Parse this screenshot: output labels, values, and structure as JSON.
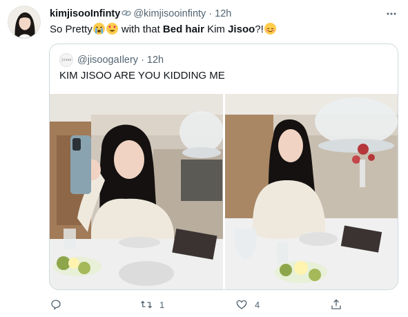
{
  "tweet": {
    "display_name": "kimjisooInfinty",
    "handle": "@kimjisooinfinty",
    "separator": "·",
    "time": "12h",
    "text": {
      "part1": "So Pretty",
      "part2": " with that ",
      "bold1": "Bed hair",
      "part3": " Kim ",
      "bold2": "Jisoo",
      "part4": "?!"
    }
  },
  "quote": {
    "avatar_text": "jisoo",
    "handle": "@jisoogaIlery",
    "separator": "·",
    "time": "12h",
    "text": "KIM JISOO ARE YOU KIDDING ME"
  },
  "actions": {
    "reply_count": "",
    "retweet_count": "1",
    "like_count": "4"
  },
  "icons": [
    "link-icon",
    "more-icon",
    "reply-icon",
    "retweet-icon",
    "like-icon",
    "share-icon"
  ],
  "colors": {
    "secondary_text": "#536471",
    "border": "#cfd9de",
    "primary_text": "#0f1419"
  }
}
